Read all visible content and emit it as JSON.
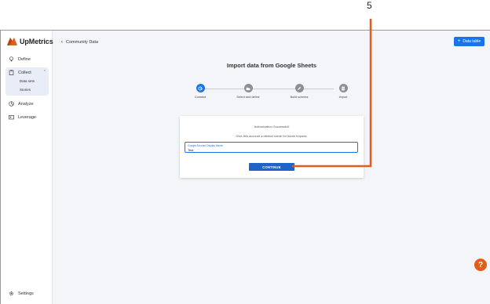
{
  "callout": {
    "number": "5"
  },
  "brand": {
    "name": "UpMetrics"
  },
  "sidebar": {
    "items": [
      {
        "label": "Define",
        "icon": "bulb-icon"
      },
      {
        "label": "Collect",
        "icon": "clipboard-icon"
      },
      {
        "label": "Analyze",
        "icon": "chart-pie-icon"
      },
      {
        "label": "Leverage",
        "icon": "id-card-icon"
      }
    ],
    "collect_sub": [
      {
        "label": "Data sets"
      },
      {
        "label": "Stories"
      }
    ],
    "settings_label": "Settings"
  },
  "header": {
    "back_label": "Community Data",
    "data_table_label": "Data table"
  },
  "page": {
    "title": "Import data from Google Sheets"
  },
  "stepper": {
    "steps": [
      {
        "label": "Connect",
        "state": "active",
        "icon": "google-icon"
      },
      {
        "label": "Select and define",
        "state": "idle",
        "icon": "folder-icon"
      },
      {
        "label": "Build schema",
        "state": "idle",
        "icon": "pencil-icon"
      },
      {
        "label": "Import",
        "state": "idle",
        "icon": "document-icon"
      }
    ]
  },
  "card": {
    "title": "Authorization Successful!",
    "subtitle": "Give this account a distinct name for future imports.",
    "field_label": "Google Account Display Name",
    "field_value": "Test",
    "continue_label": "CONTINUE"
  },
  "help": {
    "label": "?"
  },
  "colors": {
    "accent": "#1a73e8",
    "brand_orange": "#e25d1c",
    "annotation": "#e25d1c"
  }
}
